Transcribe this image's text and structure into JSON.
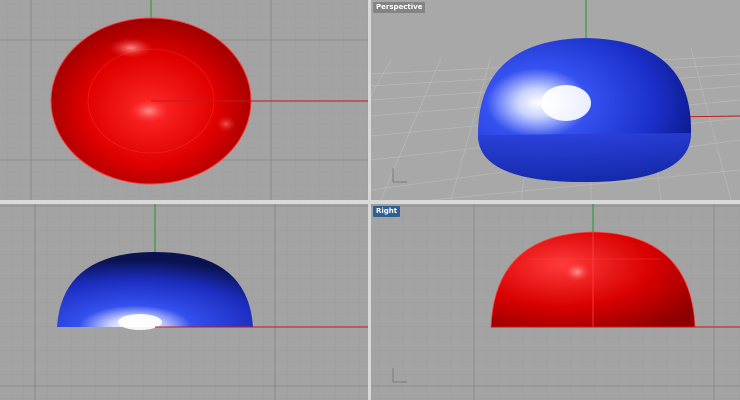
{
  "viewports": [
    {
      "id": "top",
      "label": "",
      "active": false
    },
    {
      "id": "perspective",
      "label": "Perspective",
      "active": false
    },
    {
      "id": "front",
      "label": "",
      "active": false
    },
    {
      "id": "right",
      "label": "Right",
      "active": true
    }
  ],
  "colors": {
    "viewport_bg": "#a3a3a3",
    "grid_minor": "#989898",
    "grid_major": "#8a8a8a",
    "axis_x": "#c21b1b",
    "axis_y": "#1e9a2a",
    "object_red": "#d40000",
    "object_blue": "#1a2fc8",
    "active_label": "#2f5f93"
  },
  "icons": {
    "world_axes": "world-axes-icon"
  }
}
